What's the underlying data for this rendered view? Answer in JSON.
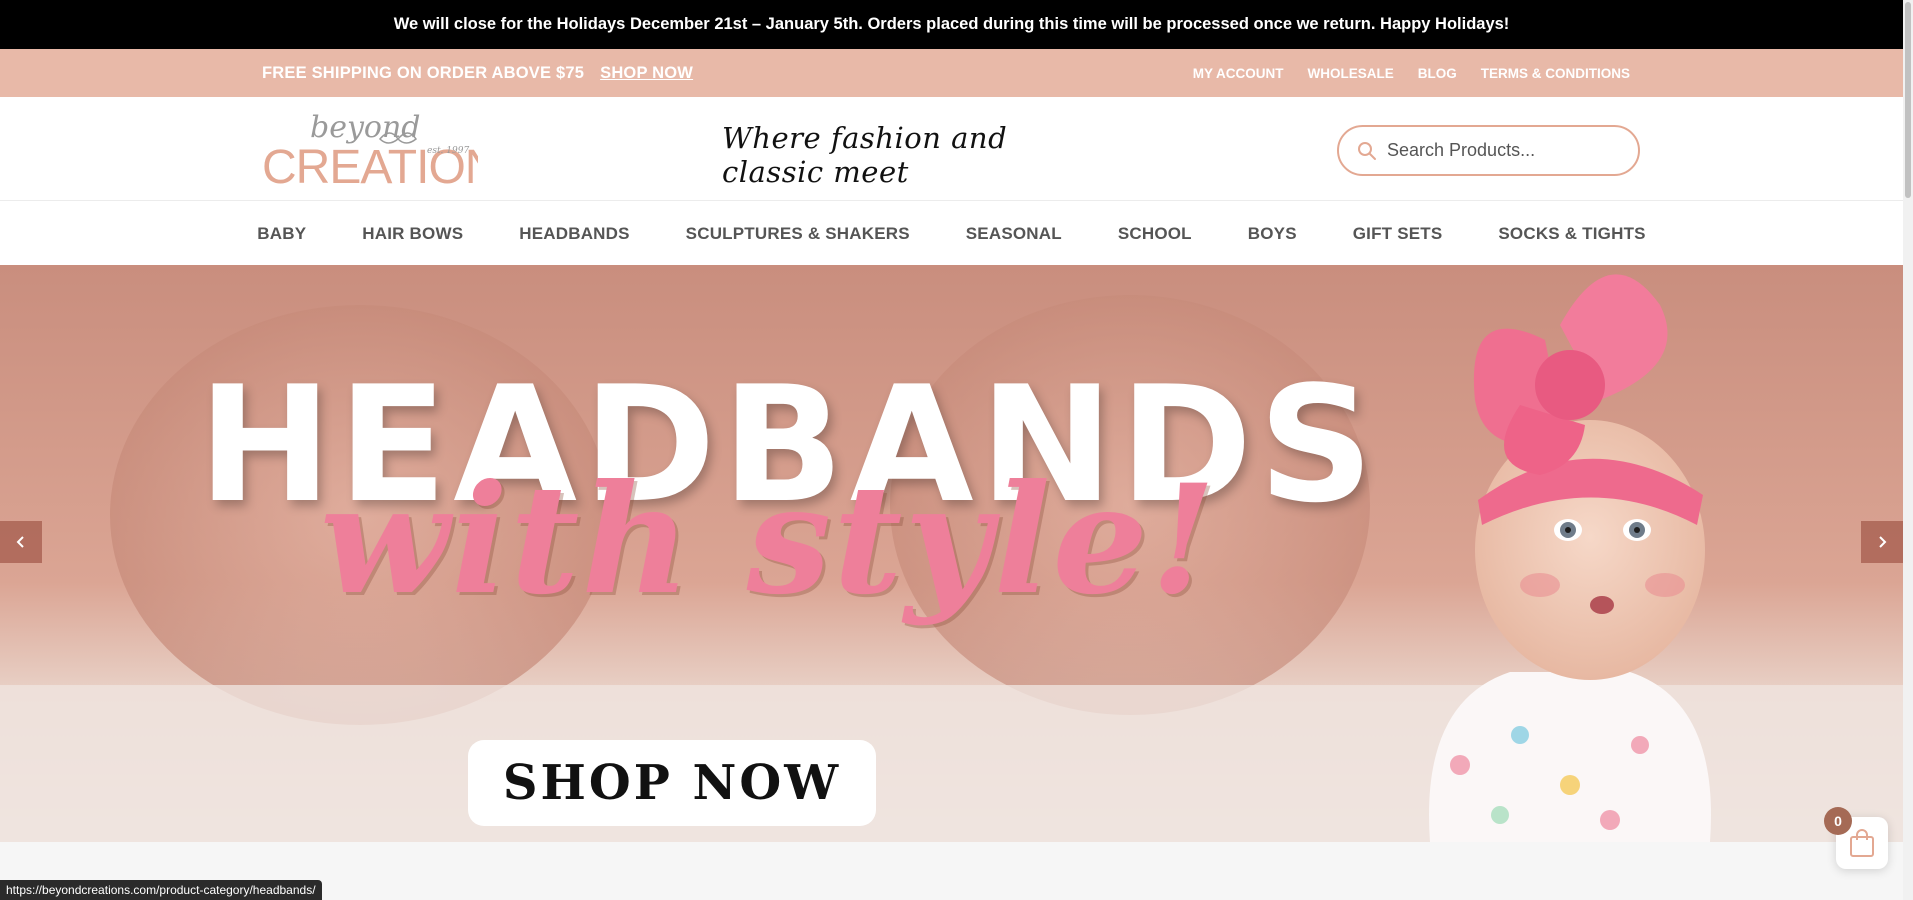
{
  "announcement": "We will close for the Holidays December 21st – January 5th. Orders placed during this time will be processed once we return. Happy Holidays!",
  "topbar": {
    "shipping_text": "FREE SHIPPING ON ORDER ABOVE $75",
    "shop_now_link": "SHOP NOW",
    "links": [
      "MY ACCOUNT",
      "WHOLESALE",
      "BLOG",
      "TERMS & CONDITIONS"
    ]
  },
  "header": {
    "logo": {
      "top": "beyond",
      "main": "CREATIONS",
      "est": "est. 1997"
    },
    "tagline": "Where fashion and classic meet",
    "search": {
      "placeholder": "Search Products...",
      "value": ""
    }
  },
  "nav": {
    "items": [
      "BABY",
      "HAIR BOWS",
      "HEADBANDS",
      "SCULPTURES & SHAKERS",
      "SEASONAL",
      "SCHOOL",
      "BOYS",
      "GIFT SETS",
      "SOCKS & TIGHTS"
    ]
  },
  "hero": {
    "title": "HEADBANDS",
    "script": "with style!",
    "button": "SHOP NOW"
  },
  "cart": {
    "count": "0"
  },
  "status_url": "https://beyondcreations.com/product-category/headbands/",
  "colors": {
    "topbar": "#e8b9a8",
    "accent": "#e3a892",
    "hero_script": "#ee7f9a",
    "cart_badge": "#a56a55"
  },
  "icons": {
    "search": "search-icon",
    "prev": "chevron-left-icon",
    "next": "chevron-right-icon",
    "cart": "shopping-bag-icon"
  }
}
